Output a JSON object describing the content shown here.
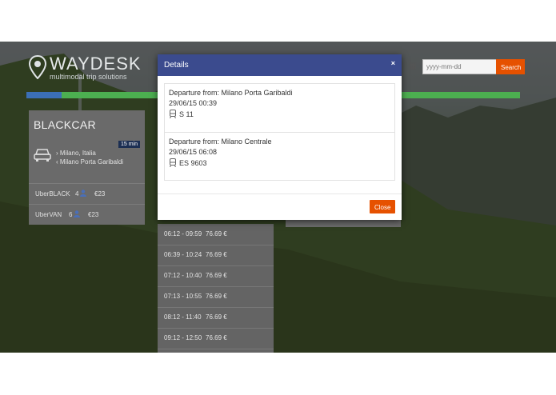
{
  "header": {
    "logo_name": "WAYDESK",
    "logo_tagline": "multimodal trip solutions",
    "date_placeholder": "yyyy-mm-dd",
    "search_label": "Search"
  },
  "blackcar_card": {
    "title": "BLACKCAR",
    "duration_badge": "15 min",
    "from": "Milano, Italia",
    "to": "Milano Porta Garibaldi",
    "options": [
      {
        "name": "UberBLACK",
        "seats": "4",
        "price": "€23"
      },
      {
        "name": "UberVAN",
        "seats": "6",
        "price": "€23"
      }
    ]
  },
  "trips": [
    {
      "time": "06:12 - 09:59",
      "price": "76.69 €"
    },
    {
      "time": "06:39 - 10:24",
      "price": "76.69 €"
    },
    {
      "time": "07:12 - 10:40",
      "price": "76.69 €"
    },
    {
      "time": "07:13 - 10:55",
      "price": "76.69 €"
    },
    {
      "time": "08:12 - 11:40",
      "price": "76.69 €"
    },
    {
      "time": "09:12 - 12:50",
      "price": "76.69 €"
    }
  ],
  "modal": {
    "title": "Details",
    "close_x": "×",
    "close_label": "Close",
    "items": [
      {
        "departure": "Departure from: Milano Porta Garibaldi",
        "datetime": "29/06/15 00:39",
        "train": "S 11"
      },
      {
        "departure": "Departure from: Milano Centrale",
        "datetime": "29/06/15 06:08",
        "train": "ES 9603"
      }
    ]
  },
  "colors": {
    "accent": "#e65100",
    "modal_header": "#3b4b8e",
    "progress_done": "#3b6fb6",
    "progress_rest": "#4caf50",
    "badge": "#1c2f53"
  }
}
